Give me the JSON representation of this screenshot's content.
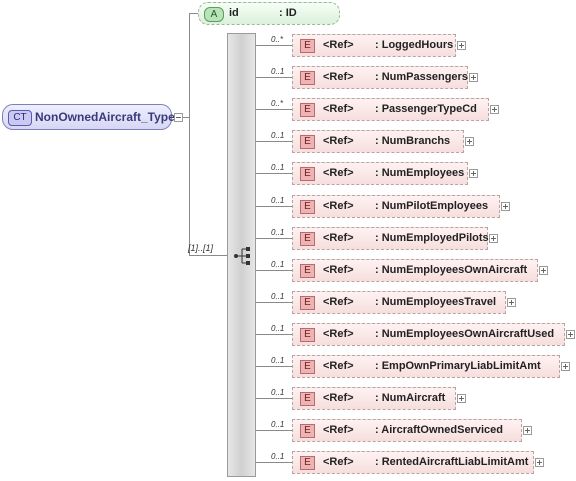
{
  "complex_type": {
    "badge": "CT",
    "name": "NonOwnedAircraft_Type"
  },
  "attribute": {
    "badge": "A",
    "name": "id",
    "type": ": ID"
  },
  "sequence": {
    "cardinality": "[1]..[1]"
  },
  "elements": [
    {
      "badge": "E",
      "ref": "<Ref>",
      "name": ": LoggedHours",
      "card": "0..*"
    },
    {
      "badge": "E",
      "ref": "<Ref>",
      "name": ": NumPassengers",
      "card": "0..1"
    },
    {
      "badge": "E",
      "ref": "<Ref>",
      "name": ": PassengerTypeCd",
      "card": "0..*"
    },
    {
      "badge": "E",
      "ref": "<Ref>",
      "name": ": NumBranchs",
      "card": "0..1"
    },
    {
      "badge": "E",
      "ref": "<Ref>",
      "name": ": NumEmployees",
      "card": "0..1"
    },
    {
      "badge": "E",
      "ref": "<Ref>",
      "name": ": NumPilotEmployees",
      "card": "0..1"
    },
    {
      "badge": "E",
      "ref": "<Ref>",
      "name": ": NumEmployedPilots",
      "card": "0..1"
    },
    {
      "badge": "E",
      "ref": "<Ref>",
      "name": ": NumEmployeesOwnAircraft",
      "card": "0..1"
    },
    {
      "badge": "E",
      "ref": "<Ref>",
      "name": ": NumEmployeesTravel",
      "card": "0..1"
    },
    {
      "badge": "E",
      "ref": "<Ref>",
      "name": ": NumEmployeesOwnAircraftUsed",
      "card": "0..1"
    },
    {
      "badge": "E",
      "ref": "<Ref>",
      "name": ": EmpOwnPrimaryLiabLimitAmt",
      "card": "0..1"
    },
    {
      "badge": "E",
      "ref": "<Ref>",
      "name": ": NumAircraft",
      "card": "0..1"
    },
    {
      "badge": "E",
      "ref": "<Ref>",
      "name": ": AircraftOwnedServiced",
      "card": "0..1"
    },
    {
      "badge": "E",
      "ref": "<Ref>",
      "name": ": RentedAircraftLiabLimitAmt",
      "card": "0..1"
    }
  ]
}
